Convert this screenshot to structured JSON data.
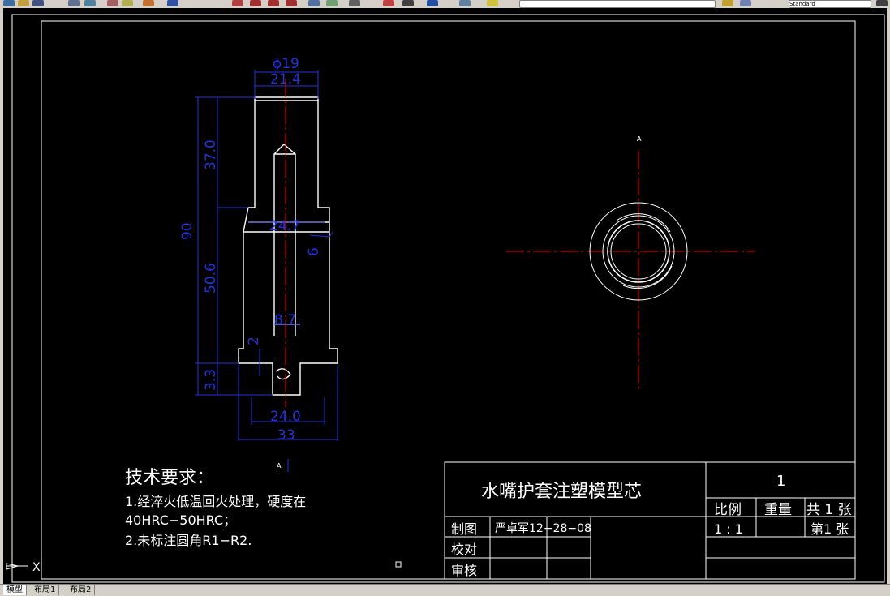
{
  "toolbar": {
    "style_name": "Standard"
  },
  "tabs": [
    "模型",
    "布局1",
    "布局2"
  ],
  "drawing": {
    "dimensions": {
      "dia_19": "ϕ19",
      "w_21_4": "21.4",
      "h_37": "37.0",
      "h_90": "90",
      "d_24_7": "24.7",
      "d_6": "6",
      "h_50_6": "50.6",
      "d_8_7": "8.7",
      "d_2": "2",
      "h_3_3": "3.3",
      "w_24": "24.0",
      "w_33": "33"
    },
    "section_mark_top": "A",
    "section_mark_bottom": "A",
    "tech": {
      "title": "技术要求：",
      "line1": "1.经淬火低温回火处理，硬度在",
      "line2": "40HRC−50HRC；",
      "line3": "2.未标注圆角R1−R2."
    },
    "title_block": {
      "name": "水嘴护套注塑模型芯",
      "sheet_number": "1",
      "scale_label": "比例",
      "weight_label": "重量",
      "total_sheets": "共 1 张",
      "scale_value": "1 : 1",
      "sheet_index": "第1 张",
      "drawn_label": "制图",
      "drawn_by": "严卓军12−28−08",
      "check_label": "校对",
      "review_label": "审核"
    },
    "ucs_label": "X"
  },
  "colors": {
    "background": "#000000",
    "outline": "#ffffff",
    "dimension": "#2233dd",
    "centerline": "#ff0000",
    "cad_ui": "#d4d0c8"
  }
}
